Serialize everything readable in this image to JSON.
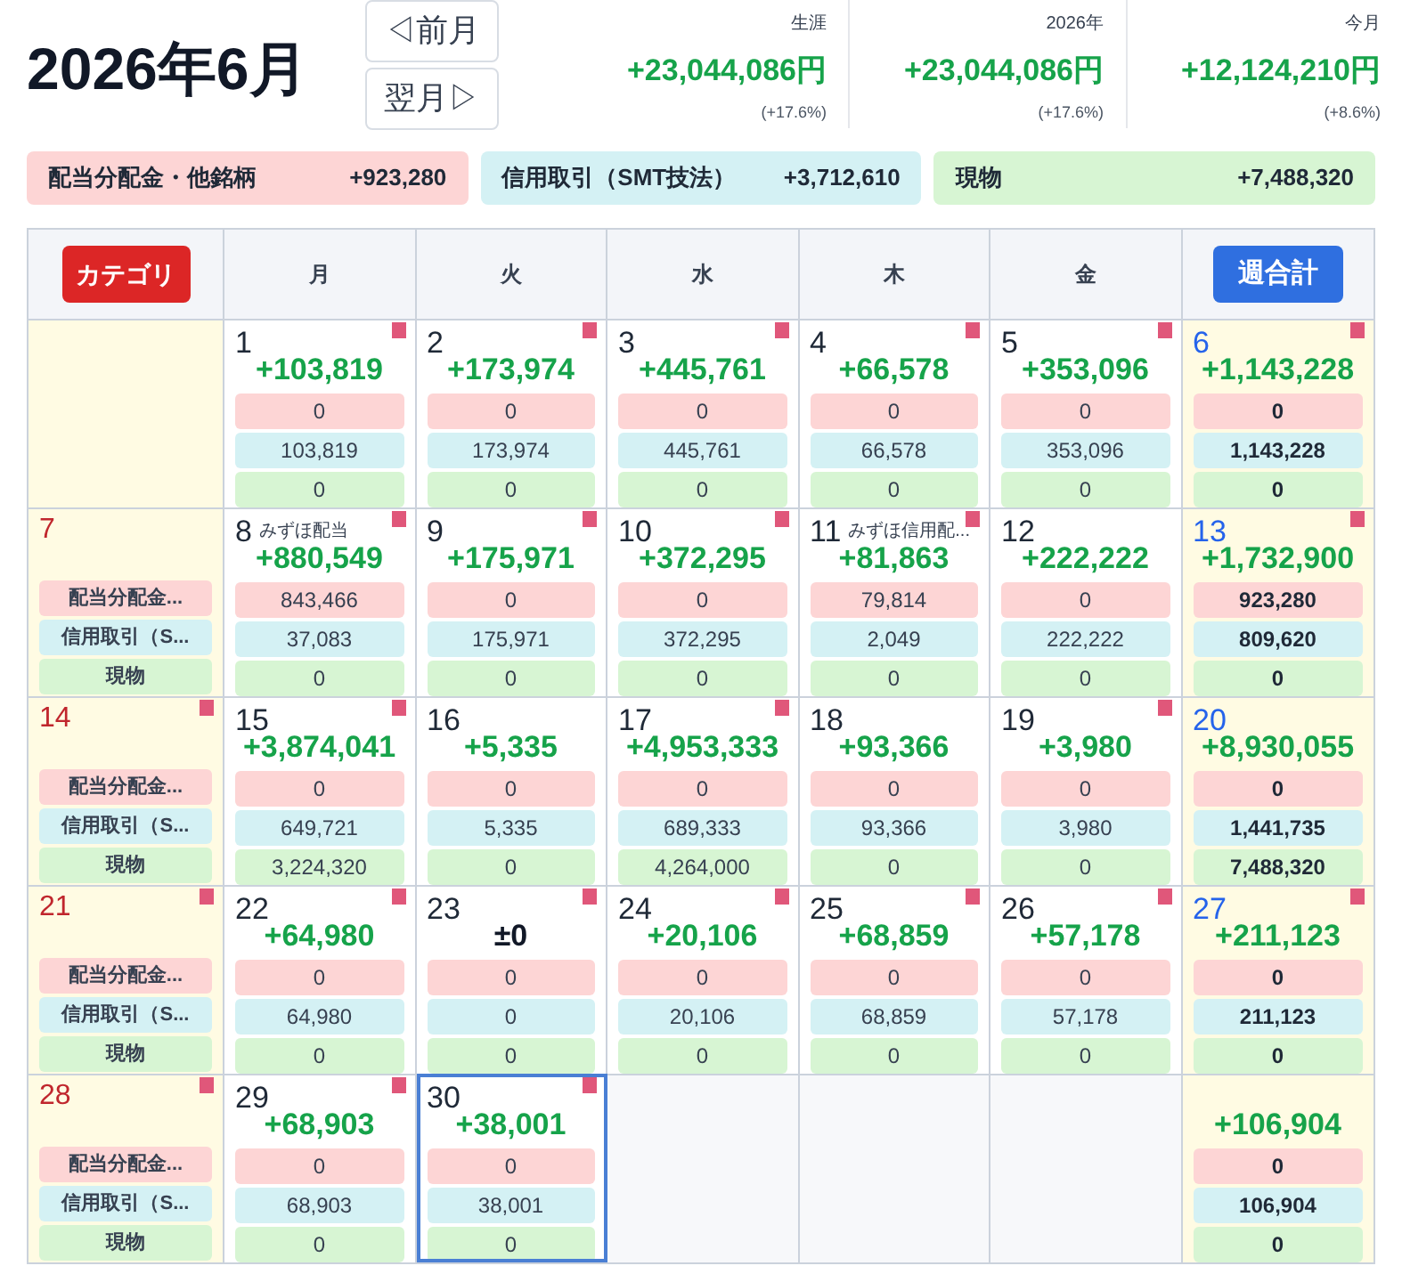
{
  "title": "2026年6月",
  "nav": [
    {
      "label": "◁前月"
    },
    {
      "label": "翌月▷"
    }
  ],
  "summaries": [
    {
      "label": "生涯",
      "amount": "+23,044,086円",
      "percent": "(+17.6%)"
    },
    {
      "label": "2026年",
      "amount": "+23,044,086円",
      "percent": "(+17.6%)"
    },
    {
      "label": "今月",
      "amount": "+12,124,210円",
      "percent": "(+8.6%)"
    }
  ],
  "categories": [
    {
      "label": "配当分配金・他銘柄",
      "amount": "+923,280",
      "color": "#fdd5d5"
    },
    {
      "label": "信用取引（SMT技法）",
      "amount": "+3,712,610",
      "color": "#d4f1f4"
    },
    {
      "label": "現物",
      "amount": "+7,488,320",
      "color": "#d7f5d3"
    }
  ],
  "header": {
    "category_button": "カテゴリ",
    "weekdays": [
      "月",
      "火",
      "水",
      "木",
      "金"
    ],
    "weekly_button": "週合計"
  },
  "weeks": [
    {
      "cells": [
        {
          "kind": "blank"
        },
        {
          "kind": "day",
          "day": "1",
          "flag": true,
          "total": "+103,819",
          "positive": true,
          "values": [
            "0",
            "103,819",
            "0"
          ],
          "selected": false
        },
        {
          "kind": "day",
          "day": "2",
          "flag": true,
          "total": "+173,974",
          "positive": true,
          "values": [
            "0",
            "173,974",
            "0"
          ],
          "selected": false
        },
        {
          "kind": "day",
          "day": "3",
          "flag": true,
          "total": "+445,761",
          "positive": true,
          "values": [
            "0",
            "445,761",
            "0"
          ],
          "selected": false
        },
        {
          "kind": "day",
          "day": "4",
          "flag": true,
          "total": "+66,578",
          "positive": true,
          "values": [
            "0",
            "66,578",
            "0"
          ],
          "selected": false
        },
        {
          "kind": "day",
          "day": "5",
          "flag": true,
          "total": "+353,096",
          "positive": true,
          "values": [
            "0",
            "353,096",
            "0"
          ],
          "selected": false
        },
        {
          "kind": "total",
          "day": "6",
          "flag": true,
          "total": "+1,143,228",
          "positive": true,
          "values": [
            "0",
            "1,143,228",
            "0"
          ]
        }
      ]
    },
    {
      "cells": [
        {
          "kind": "labels",
          "day": "7",
          "flag": false,
          "labels": [
            "配当分配金...",
            "信用取引（S...",
            "現物"
          ]
        },
        {
          "kind": "day",
          "day": "8",
          "note": "みずほ配当",
          "flag": true,
          "total": "+880,549",
          "positive": true,
          "values": [
            "843,466",
            "37,083",
            "0"
          ],
          "selected": false
        },
        {
          "kind": "day",
          "day": "9",
          "flag": true,
          "total": "+175,971",
          "positive": true,
          "values": [
            "0",
            "175,971",
            "0"
          ],
          "selected": false
        },
        {
          "kind": "day",
          "day": "10",
          "flag": true,
          "total": "+372,295",
          "positive": true,
          "values": [
            "0",
            "372,295",
            "0"
          ],
          "selected": false
        },
        {
          "kind": "day",
          "day": "11",
          "note": "みずほ信用配...",
          "flag": true,
          "total": "+81,863",
          "positive": true,
          "values": [
            "79,814",
            "2,049",
            "0"
          ],
          "selected": false
        },
        {
          "kind": "day",
          "day": "12",
          "flag": false,
          "total": "+222,222",
          "positive": true,
          "values": [
            "0",
            "222,222",
            "0"
          ],
          "selected": false
        },
        {
          "kind": "total",
          "day": "13",
          "flag": true,
          "total": "+1,732,900",
          "positive": true,
          "values": [
            "923,280",
            "809,620",
            "0"
          ]
        }
      ]
    },
    {
      "cells": [
        {
          "kind": "labels",
          "day": "14",
          "flag": true,
          "labels": [
            "配当分配金...",
            "信用取引（S...",
            "現物"
          ]
        },
        {
          "kind": "day",
          "day": "15",
          "flag": true,
          "total": "+3,874,041",
          "positive": true,
          "values": [
            "0",
            "649,721",
            "3,224,320"
          ],
          "selected": false
        },
        {
          "kind": "day",
          "day": "16",
          "flag": false,
          "total": "+5,335",
          "positive": true,
          "values": [
            "0",
            "5,335",
            "0"
          ],
          "selected": false
        },
        {
          "kind": "day",
          "day": "17",
          "flag": true,
          "total": "+4,953,333",
          "positive": true,
          "values": [
            "0",
            "689,333",
            "4,264,000"
          ],
          "selected": false
        },
        {
          "kind": "day",
          "day": "18",
          "flag": false,
          "total": "+93,366",
          "positive": true,
          "values": [
            "0",
            "93,366",
            "0"
          ],
          "selected": false
        },
        {
          "kind": "day",
          "day": "19",
          "flag": true,
          "total": "+3,980",
          "positive": true,
          "values": [
            "0",
            "3,980",
            "0"
          ],
          "selected": false
        },
        {
          "kind": "total",
          "day": "20",
          "flag": false,
          "total": "+8,930,055",
          "positive": true,
          "values": [
            "0",
            "1,441,735",
            "7,488,320"
          ]
        }
      ]
    },
    {
      "cells": [
        {
          "kind": "labels",
          "day": "21",
          "flag": true,
          "labels": [
            "配当分配金...",
            "信用取引（S...",
            "現物"
          ]
        },
        {
          "kind": "day",
          "day": "22",
          "flag": true,
          "total": "+64,980",
          "positive": true,
          "values": [
            "0",
            "64,980",
            "0"
          ],
          "selected": false
        },
        {
          "kind": "day",
          "day": "23",
          "flag": true,
          "total": "±0",
          "positive": false,
          "values": [
            "0",
            "0",
            "0"
          ],
          "selected": false
        },
        {
          "kind": "day",
          "day": "24",
          "flag": true,
          "total": "+20,106",
          "positive": true,
          "values": [
            "0",
            "20,106",
            "0"
          ],
          "selected": false
        },
        {
          "kind": "day",
          "day": "25",
          "flag": true,
          "total": "+68,859",
          "positive": true,
          "values": [
            "0",
            "68,859",
            "0"
          ],
          "selected": false
        },
        {
          "kind": "day",
          "day": "26",
          "flag": true,
          "total": "+57,178",
          "positive": true,
          "values": [
            "0",
            "57,178",
            "0"
          ],
          "selected": false
        },
        {
          "kind": "total",
          "day": "27",
          "flag": true,
          "total": "+211,123",
          "positive": true,
          "values": [
            "0",
            "211,123",
            "0"
          ]
        }
      ]
    },
    {
      "cells": [
        {
          "kind": "labels",
          "day": "28",
          "flag": true,
          "labels": [
            "配当分配金...",
            "信用取引（S...",
            "現物"
          ]
        },
        {
          "kind": "day",
          "day": "29",
          "flag": true,
          "total": "+68,903",
          "positive": true,
          "values": [
            "0",
            "68,903",
            "0"
          ],
          "selected": false
        },
        {
          "kind": "day",
          "day": "30",
          "flag": true,
          "total": "+38,001",
          "positive": true,
          "values": [
            "0",
            "38,001",
            "0"
          ],
          "selected": true
        },
        {
          "kind": "empty"
        },
        {
          "kind": "empty"
        },
        {
          "kind": "empty"
        },
        {
          "kind": "total",
          "flag": false,
          "total": "+106,904",
          "positive": true,
          "values": [
            "0",
            "106,904",
            "0"
          ]
        }
      ]
    }
  ]
}
